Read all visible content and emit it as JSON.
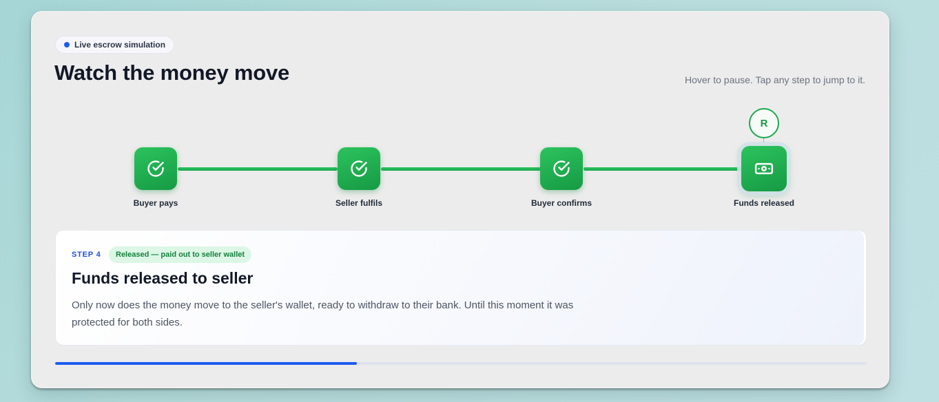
{
  "header": {
    "badge_label": "Live escrow simulation",
    "title": "Watch the money move",
    "hint": "Hover to pause. Tap any step to jump to it."
  },
  "steps": [
    {
      "label": "Buyer pays",
      "icon": "check-circle-icon",
      "state": "complete"
    },
    {
      "label": "Seller fulfils",
      "icon": "check-circle-icon",
      "state": "complete"
    },
    {
      "label": "Buyer confirms",
      "icon": "check-circle-icon",
      "state": "complete"
    },
    {
      "label": "Funds released",
      "icon": "banknote-icon",
      "state": "active"
    }
  ],
  "marker": {
    "initial": "R"
  },
  "detail": {
    "step_label": "STEP 4",
    "status": "Released — paid out to seller wallet",
    "title": "Funds released to seller",
    "body": "Only now does the money move to the seller's wallet, ready to withdraw to their bank. Until this moment it was protected for both sides."
  },
  "progress": {
    "fraction": 0.372
  },
  "colors": {
    "accent_blue": "#1d5cf0",
    "success_green": "#1ea84f",
    "badge_green_bg": "#dcf7e6"
  }
}
